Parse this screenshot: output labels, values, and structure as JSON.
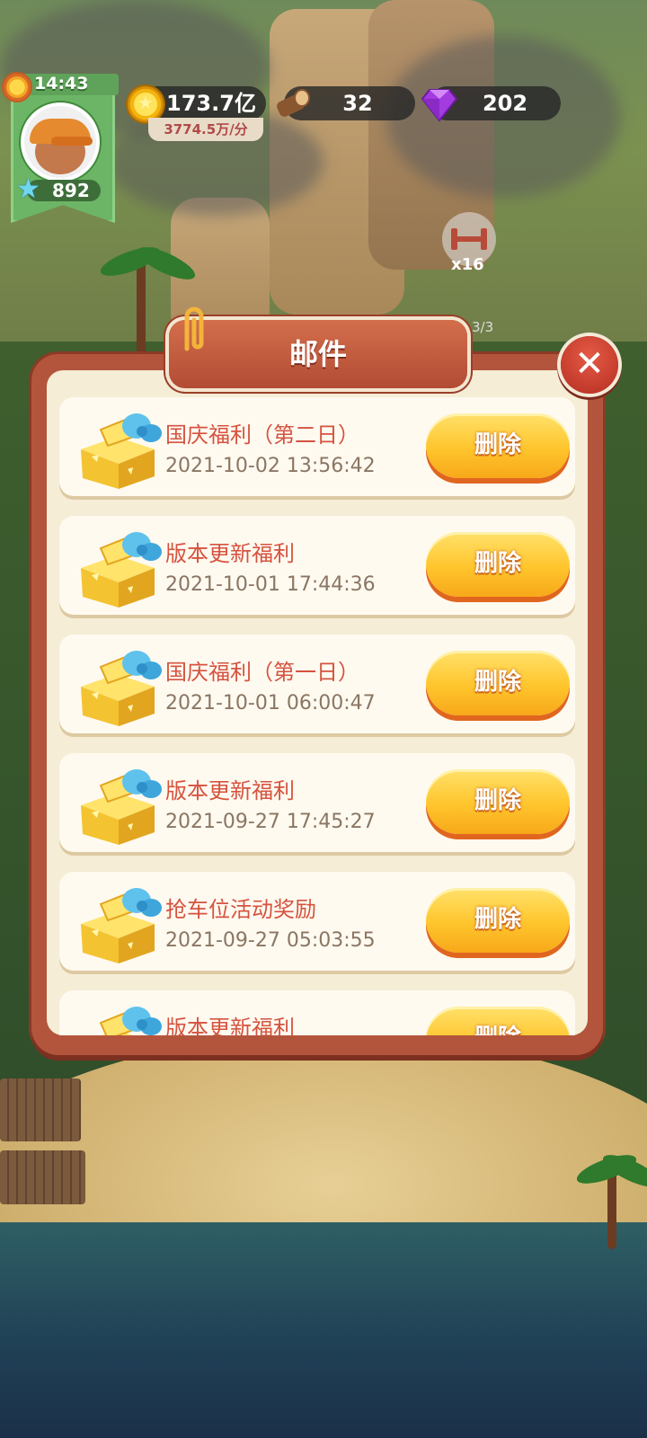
{
  "hud": {
    "time": "14:43",
    "level": "892",
    "coins": "173.7亿",
    "coin_rate": "3774.5万/分",
    "wood": "32",
    "gems": "202"
  },
  "scene": {
    "building_badge": "x16",
    "progress_count": "3/3"
  },
  "mail_dialog": {
    "title": "邮件",
    "close_symbol": "✕",
    "items": [
      {
        "title": "国庆福利（第二日）",
        "time": "2021-10-02 13:56:42",
        "delete_label": "删除"
      },
      {
        "title": "版本更新福利",
        "time": "2021-10-01 17:44:36",
        "delete_label": "删除"
      },
      {
        "title": "国庆福利（第一日）",
        "time": "2021-10-01 06:00:47",
        "delete_label": "删除"
      },
      {
        "title": "版本更新福利",
        "time": "2021-09-27 17:45:27",
        "delete_label": "删除"
      },
      {
        "title": "抢车位活动奖励",
        "time": "2021-09-27 05:03:55",
        "delete_label": "删除"
      },
      {
        "title": "版本更新福利",
        "time": "",
        "delete_label": "删除"
      }
    ]
  },
  "colors": {
    "dialog_frame": "#b3553c",
    "dialog_bg": "#f6edd6",
    "mail_title": "#d5533f",
    "delete_button": "#ffc52c"
  }
}
